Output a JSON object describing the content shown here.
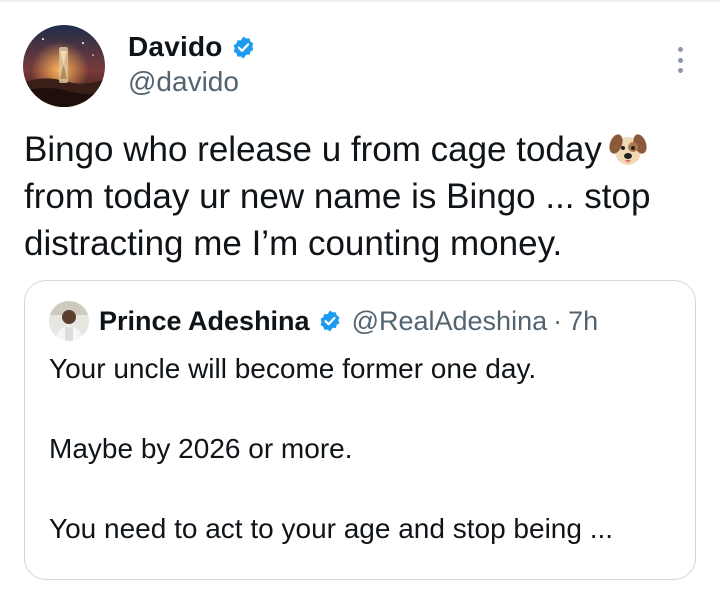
{
  "post": {
    "author": {
      "name": "Davido",
      "handle": "@davido",
      "avatar_icon": "avatar-image",
      "verified_icon": "verified-badge-icon"
    },
    "more_icon": "more-options-icon",
    "text_lines": [
      "Bingo who release u from cage today",
      "from today ur new name is Bingo ... stop",
      "distracting me I’m counting money."
    ],
    "emoji_icon": "dog-face-icon"
  },
  "quote": {
    "author": {
      "name": "Prince Adeshina",
      "handle": "@RealAdeshina",
      "separator": "·",
      "time": "7h",
      "avatar_icon": "avatar-image",
      "verified_icon": "verified-badge-icon"
    },
    "paragraphs": [
      "Your uncle will become former one day.",
      "Maybe by 2026 or more.",
      "You need to act to your age and stop being ..."
    ]
  },
  "colors": {
    "text_primary": "#0f1419",
    "text_secondary": "#536471",
    "verified_blue": "#1d9bf0",
    "border": "#cfd9de"
  }
}
